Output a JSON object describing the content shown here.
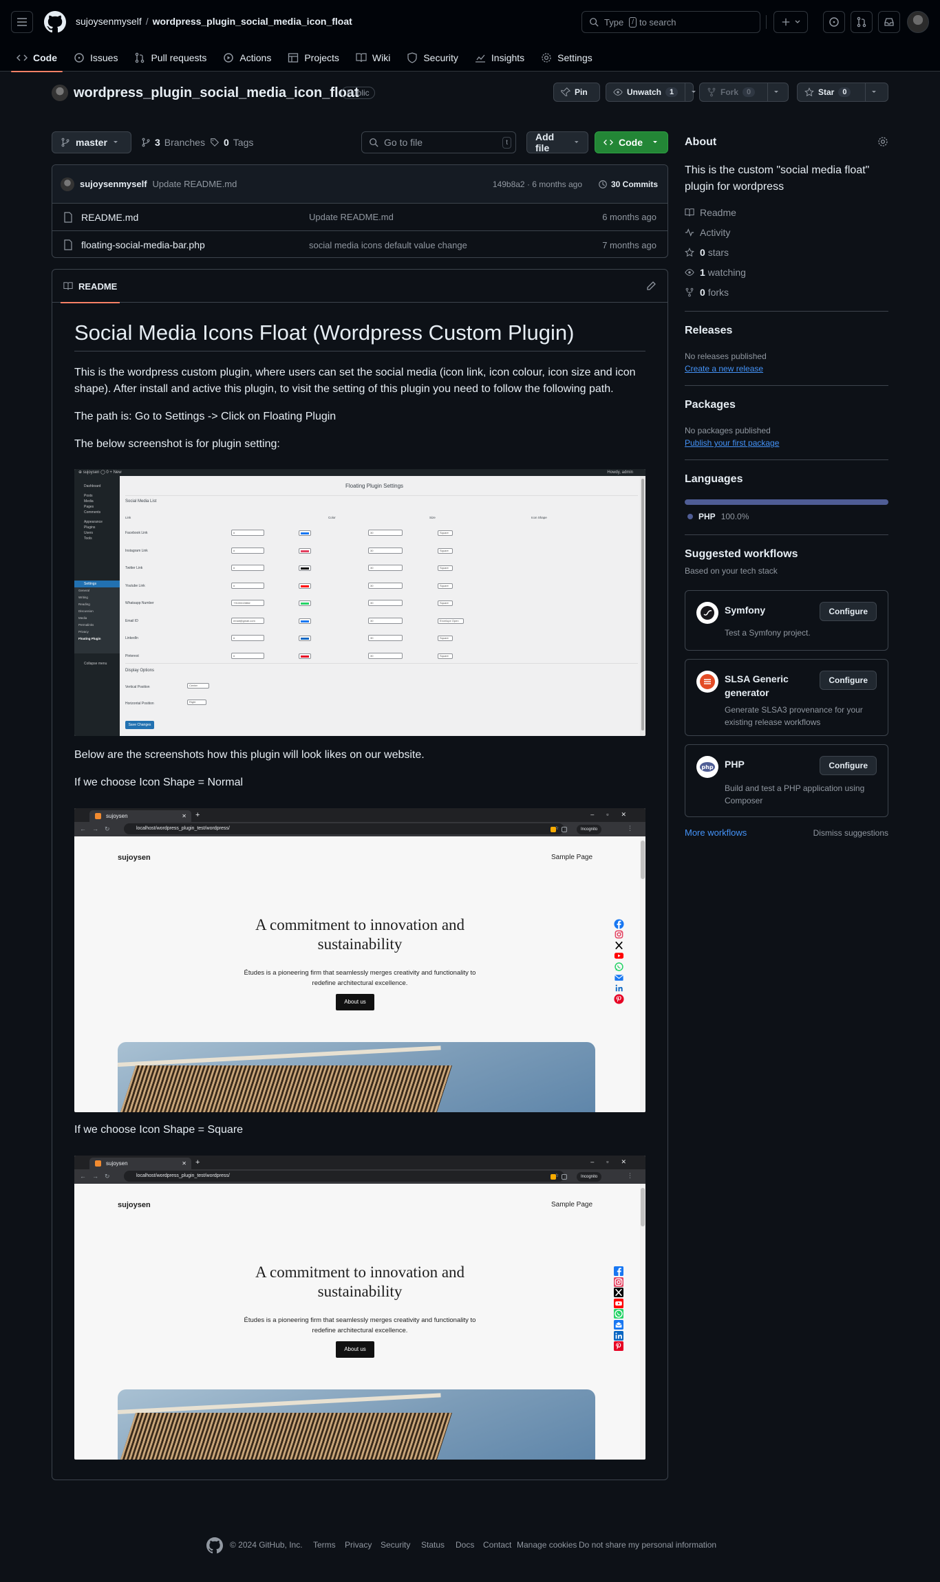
{
  "header": {
    "owner": "sujoysenmyself",
    "repo": "wordpress_plugin_social_media_icon_float",
    "search_pre": "Type",
    "search_key": "/",
    "search_post": "to search"
  },
  "tabs": [
    {
      "label": "Code",
      "icon": "code-icon"
    },
    {
      "label": "Issues",
      "icon": "issue-icon"
    },
    {
      "label": "Pull requests",
      "icon": "pull-request-icon"
    },
    {
      "label": "Actions",
      "icon": "play-icon"
    },
    {
      "label": "Projects",
      "icon": "table-icon"
    },
    {
      "label": "Wiki",
      "icon": "book-icon"
    },
    {
      "label": "Security",
      "icon": "shield-icon"
    },
    {
      "label": "Insights",
      "icon": "graph-icon"
    },
    {
      "label": "Settings",
      "icon": "gear-icon"
    }
  ],
  "repo": {
    "name": "wordpress_plugin_social_media_icon_float",
    "visibility": "Public",
    "pin": "Pin",
    "unwatch": "Unwatch",
    "unwatch_count": "1",
    "fork": "Fork",
    "fork_count": "0",
    "star": "Star",
    "star_count": "0"
  },
  "toolbar": {
    "branch": "master",
    "branches_count": "3",
    "branches_label": "Branches",
    "tags_count": "0",
    "tags_label": "Tags",
    "goto_placeholder": "Go to file",
    "goto_key": "t",
    "add_file": "Add file",
    "code": "Code"
  },
  "commit": {
    "author": "sujoysenmyself",
    "message": "Update README.md",
    "meta": "149b8a2 · 6 months ago",
    "count": "30 Commits"
  },
  "files": [
    {
      "name": "README.md",
      "message": "Update README.md",
      "age": "6 months ago"
    },
    {
      "name": "floating-social-media-bar.php",
      "message": "social media icons default value change",
      "age": "7 months ago"
    }
  ],
  "readme": {
    "tab": "README",
    "title": "Social Media Icons Float (Wordpress Custom Plugin)",
    "p1": "This is the wordpress custom plugin, where users can set the social media (icon link, icon colour, icon size and icon shape). After install and active this plugin, to visit the setting of this plugin you need to follow the following path.",
    "p2": "The path is: Go to Settings -> Click on Floating Plugin",
    "p3": "The below screenshot is for plugin setting:",
    "p4": "Below are the screenshots how this plugin will look likes on our website.",
    "p5": "If we choose Icon Shape = Normal",
    "p6": "If we choose Icon Shape = Square"
  },
  "settings_shot": {
    "page_title": "Floating Plugin Settings",
    "section": "Social Media List",
    "col_link": "Link",
    "col_color": "Color",
    "col_size": "Size",
    "col_shape": "Icon Shape",
    "howdy": "Howdy, admin",
    "sidebar": [
      "Dashboard",
      "Posts",
      "Media",
      "Pages",
      "Comments",
      "Appearance",
      "Plugins",
      "Users",
      "Tools",
      "Settings",
      "General",
      "Writing",
      "Reading",
      "Discussion",
      "Media",
      "Permalinks",
      "Privacy",
      "Floating Plugin",
      "Collapse menu"
    ],
    "rows": [
      {
        "label": "Facebook Link",
        "link": "#",
        "color": "#1877f2",
        "size": "30",
        "shape": "Square"
      },
      {
        "label": "Instagram Link",
        "link": "#",
        "color": "#e4405f",
        "size": "30",
        "shape": "Square"
      },
      {
        "label": "Twitter Link",
        "link": "#",
        "color": "#000000",
        "size": "30",
        "shape": "Square"
      },
      {
        "label": "Youtube Link",
        "link": "#",
        "color": "#ff0000",
        "size": "30",
        "shape": "Square"
      },
      {
        "label": "Whatsapp Number",
        "link": "+910041588#",
        "color": "#25d366",
        "size": "30",
        "shape": "Square"
      },
      {
        "label": "Email ID",
        "link": "email@gmail.com",
        "color": "#1877f2",
        "size": "30",
        "shape": "Envelope Open"
      },
      {
        "label": "LinkedIn",
        "link": "#",
        "color": "#0a66c2",
        "size": "30",
        "shape": "Square"
      },
      {
        "label": "Pinterest",
        "link": "#",
        "color": "#e60023",
        "size": "30",
        "shape": "Square"
      }
    ],
    "display_options": "Display Options",
    "vertical_label": "Vertical Position",
    "vertical_value": "Center",
    "horizontal_label": "Horizontal Position",
    "horizontal_value": "Right",
    "save": "Save Changes"
  },
  "browser_shot": {
    "tab_title": "sujoysen",
    "url": "localhost/wordpress_plugin_test/wordpress/",
    "incognito": "Incognito",
    "site_name": "sujoysen",
    "nav_link": "Sample Page",
    "hero": "A commitment to innovation and sustainability",
    "sub": "Études is a pioneering firm that seamlessly merges creativity and functionality to redefine architectural excellence.",
    "button": "About us",
    "icons": [
      {
        "name": "facebook",
        "color": "#1877f2"
      },
      {
        "name": "instagram",
        "color": "#e4405f"
      },
      {
        "name": "x",
        "color": "#000000"
      },
      {
        "name": "youtube",
        "color": "#ff0000"
      },
      {
        "name": "whatsapp",
        "color": "#25d366"
      },
      {
        "name": "email",
        "color": "#1877f2"
      },
      {
        "name": "linkedin",
        "color": "#0a66c2"
      },
      {
        "name": "pinterest",
        "color": "#e60023"
      }
    ]
  },
  "sidebar": {
    "about_title": "About",
    "about_text": "This is the custom \"social media float\" plugin for wordpress",
    "readme": "Readme",
    "activity": "Activity",
    "stars_count": "0",
    "stars_label": "stars",
    "watching_count": "1",
    "watching_label": "watching",
    "forks_count": "0",
    "forks_label": "forks",
    "releases_title": "Releases",
    "releases_text": "No releases published",
    "releases_link": "Create a new release",
    "packages_title": "Packages",
    "packages_text": "No packages published",
    "packages_link": "Publish your first package",
    "languages_title": "Languages",
    "lang_name": "PHP",
    "lang_pct": "100.0%",
    "lang_color": "#4f5d95",
    "wf_title": "Suggested workflows",
    "wf_sub": "Based on your tech stack",
    "workflows": [
      {
        "name": "Symfony",
        "desc": "Test a Symfony project.",
        "btn": "Configure"
      },
      {
        "name": "SLSA Generic generator",
        "desc": "Generate SLSA3 provenance for your existing release workflows",
        "btn": "Configure"
      },
      {
        "name": "PHP",
        "desc": "Build and test a PHP application using Composer",
        "btn": "Configure"
      }
    ],
    "more": "More workflows",
    "dismiss": "Dismiss suggestions"
  },
  "footer": {
    "copyright": "© 2024 GitHub, Inc.",
    "links": [
      "Terms",
      "Privacy",
      "Security",
      "Status",
      "Docs",
      "Contact",
      "Manage cookies",
      "Do not share my personal information"
    ]
  },
  "colors": {
    "accent": "#f78166",
    "green": "#238636",
    "link": "#4493f8"
  }
}
